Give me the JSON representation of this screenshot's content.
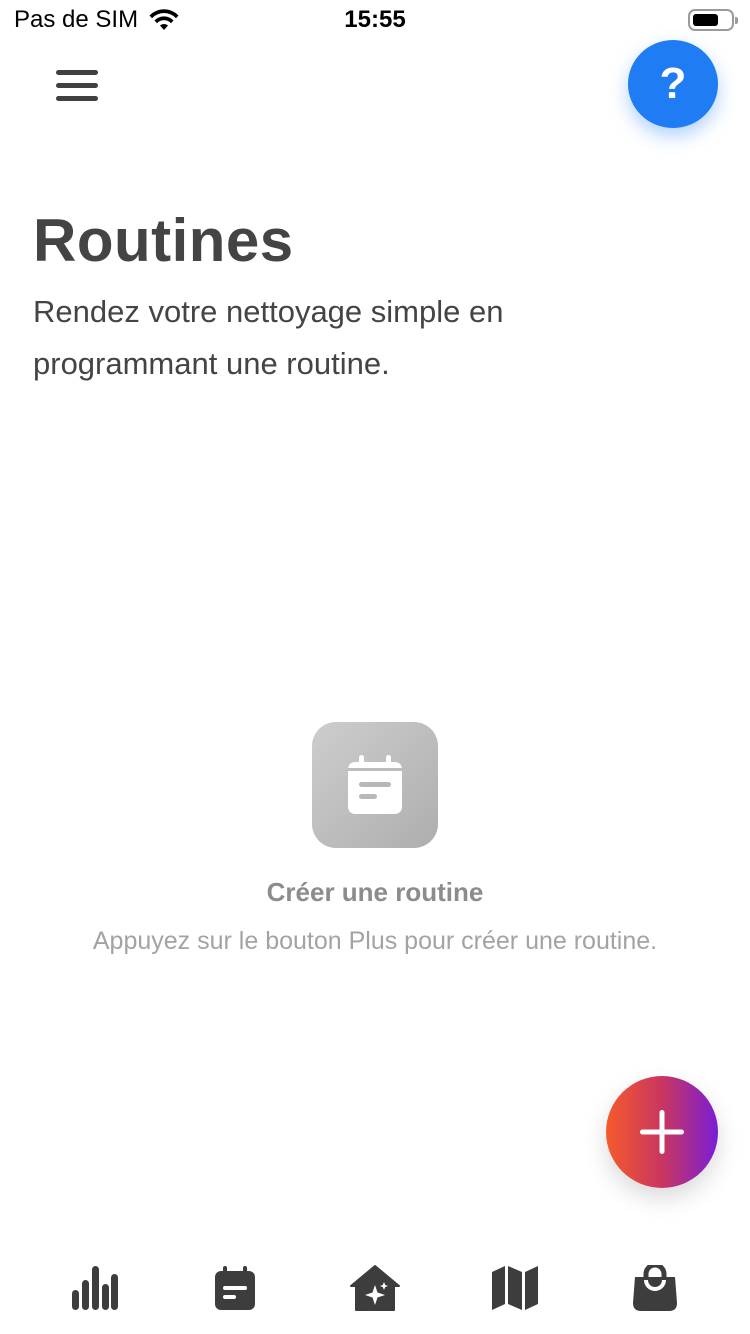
{
  "status_bar": {
    "carrier": "Pas de SIM",
    "time": "15:55",
    "battery_level": 0.7
  },
  "header": {
    "menu_icon": "hamburger-menu-icon",
    "help_label": "?"
  },
  "page": {
    "title": "Routines",
    "subtitle": "Rendez votre nettoyage simple en programmant une routine."
  },
  "empty_state": {
    "icon": "calendar-note-icon",
    "title": "Créer une routine",
    "description": "Appuyez sur le bouton Plus pour créer une routine."
  },
  "add_button": {
    "icon": "plus-icon",
    "gradient": [
      "#f55a2c",
      "#c9365f",
      "#7a1ed6"
    ]
  },
  "bottom_nav": {
    "items": [
      {
        "icon": "stats-bars-icon"
      },
      {
        "icon": "calendar-note-icon"
      },
      {
        "icon": "home-sparkle-icon"
      },
      {
        "icon": "map-icon"
      },
      {
        "icon": "shopping-bag-icon"
      }
    ]
  },
  "colors": {
    "help_blue": "#1f7cf3",
    "text_dark": "#444444",
    "text_muted": "#8c8c8c"
  }
}
